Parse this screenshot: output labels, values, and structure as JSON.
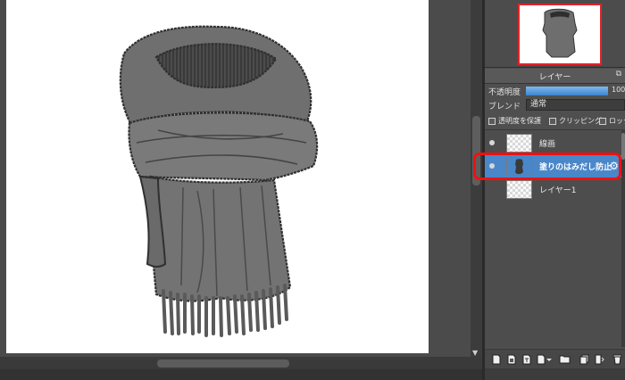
{
  "panel": {
    "layer_title": "レイヤー",
    "opacity_label": "不透明度",
    "opacity_value": "100",
    "opacity_percent": 100,
    "blend_label": "ブレンド",
    "blend_value": "通常",
    "checks": {
      "protect_alpha": "透明度を保護",
      "clipping": "クリッピング",
      "lock": "ロック"
    },
    "layers": [
      {
        "name": "線画",
        "selected": false
      },
      {
        "name": "塗りのはみだし防止",
        "selected": true
      },
      {
        "name": "レイヤー1",
        "selected": false
      }
    ]
  },
  "colors": {
    "selection": "#4a87c9",
    "highlight": "#ee1111",
    "navigator_frame": "#e0242a",
    "opacity_bar": "#3d86d1"
  },
  "icons": {
    "gear": "gear-icon",
    "eye": "eye-icon",
    "expand": "expand-icon",
    "toolbar": [
      "new-layer-icon",
      "new-halftone-layer-icon",
      "new-text-layer-icon",
      "add-layer-dropdown-icon",
      "folder-icon",
      "duplicate-layer-icon",
      "merge-down-icon",
      "delete-layer-icon"
    ]
  }
}
